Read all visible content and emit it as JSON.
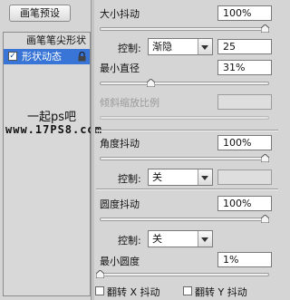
{
  "left_panel": {
    "preset_button": "画笔预设",
    "items": [
      {
        "label": "画笔笔尖形状"
      },
      {
        "label": "形状动态",
        "checked": true,
        "selected": true
      }
    ],
    "watermark": {
      "line1": "一起ps吧",
      "line2": "www.17PS8.com"
    }
  },
  "size_jitter": {
    "label": "大小抖动",
    "value": "100%",
    "slider_fraction": 1.0
  },
  "size_control": {
    "label": "控制:",
    "selected": "渐隐",
    "value": "25"
  },
  "min_diameter": {
    "label": "最小直径",
    "value": "31%",
    "slider_fraction": 0.31
  },
  "tilt_scale": {
    "label": "倾斜缩放比例",
    "value": "",
    "disabled": true
  },
  "angle_jitter": {
    "label": "角度抖动",
    "value": "100%",
    "slider_fraction": 1.0
  },
  "angle_control": {
    "label": "控制:",
    "selected": "关",
    "value": ""
  },
  "roundness_jitter": {
    "label": "圆度抖动",
    "value": "100%",
    "slider_fraction": 1.0
  },
  "roundness_control": {
    "label": "控制:",
    "selected": "关"
  },
  "min_roundness": {
    "label": "最小圆度",
    "value": "1%",
    "slider_fraction": 0.01
  },
  "flips": {
    "flip_x": "翻转 X 抖动",
    "flip_y": "翻转 Y 抖动"
  },
  "colors": {
    "selection": "#3875d7"
  }
}
